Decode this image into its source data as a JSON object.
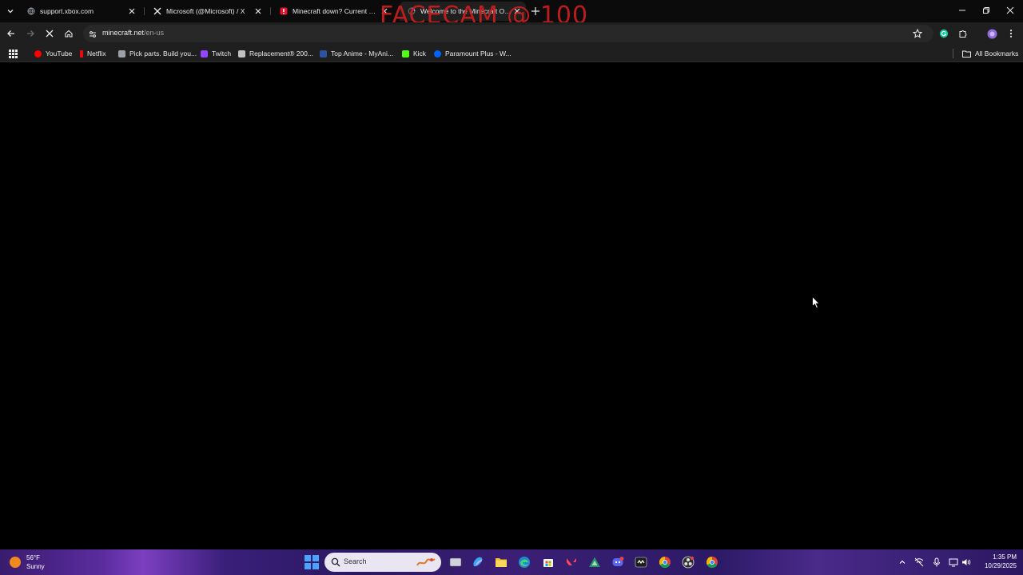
{
  "browser": {
    "tabs": [
      {
        "title": "support.xbox.com",
        "favicon": "globe-icon",
        "active": false
      },
      {
        "title": "Microsoft (@Microsoft) / X",
        "favicon": "x-logo-icon",
        "active": false
      },
      {
        "title": "Minecraft down? Current status",
        "favicon": "downdetector-icon",
        "active": false
      },
      {
        "title": "Welcome to the Minecraft Official",
        "favicon": "loading-icon",
        "active": true
      }
    ],
    "url_host": "minecraft.net",
    "url_path": "/en-us"
  },
  "overlay": {
    "facecam_text": "FACECAM @ 100"
  },
  "bookmarks": {
    "items": [
      {
        "label": "YouTube",
        "icon": "youtube-icon",
        "color": "#ff0000"
      },
      {
        "label": "Netflix",
        "icon": "netflix-icon",
        "color": "#e50914"
      },
      {
        "label": "Pick parts. Build you...",
        "icon": "pcpartpicker-icon",
        "color": "#9aa0a6"
      },
      {
        "label": "Twitch",
        "icon": "twitch-icon",
        "color": "#9146ff"
      },
      {
        "label": "Replacement® 200...",
        "icon": "site-icon",
        "color": "#c0c0c0"
      },
      {
        "label": "Top Anime - MyAni...",
        "icon": "myanimelist-icon",
        "color": "#2e51a2"
      },
      {
        "label": "Kick",
        "icon": "kick-icon",
        "color": "#53fc18"
      },
      {
        "label": "Paramount Plus - W...",
        "icon": "paramount-icon",
        "color": "#0064ff"
      }
    ],
    "all_bookmarks_label": "All Bookmarks"
  },
  "taskbar": {
    "temperature": "56°F",
    "condition": "Sunny",
    "search_placeholder": "Search",
    "time": "1:35 PM",
    "date": "10/29/2025"
  }
}
